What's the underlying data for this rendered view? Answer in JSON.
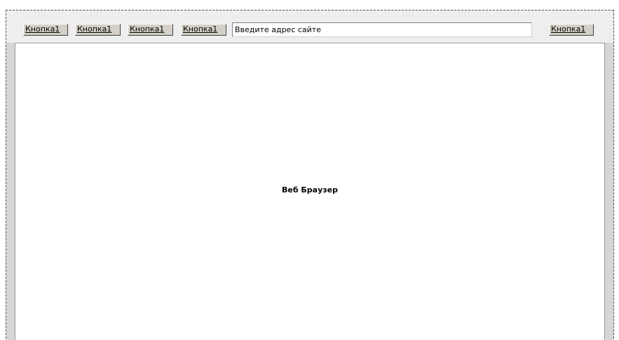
{
  "toolbar": {
    "buttons": [
      {
        "label": "Кнопка1"
      },
      {
        "label": "Кнопка1"
      },
      {
        "label": "Кнопка1"
      },
      {
        "label": "Кнопка1"
      }
    ],
    "address_text": "Введите адрес сайте",
    "go_button_label": "Кнопка1"
  },
  "content": {
    "label": "Веб Браузер"
  }
}
